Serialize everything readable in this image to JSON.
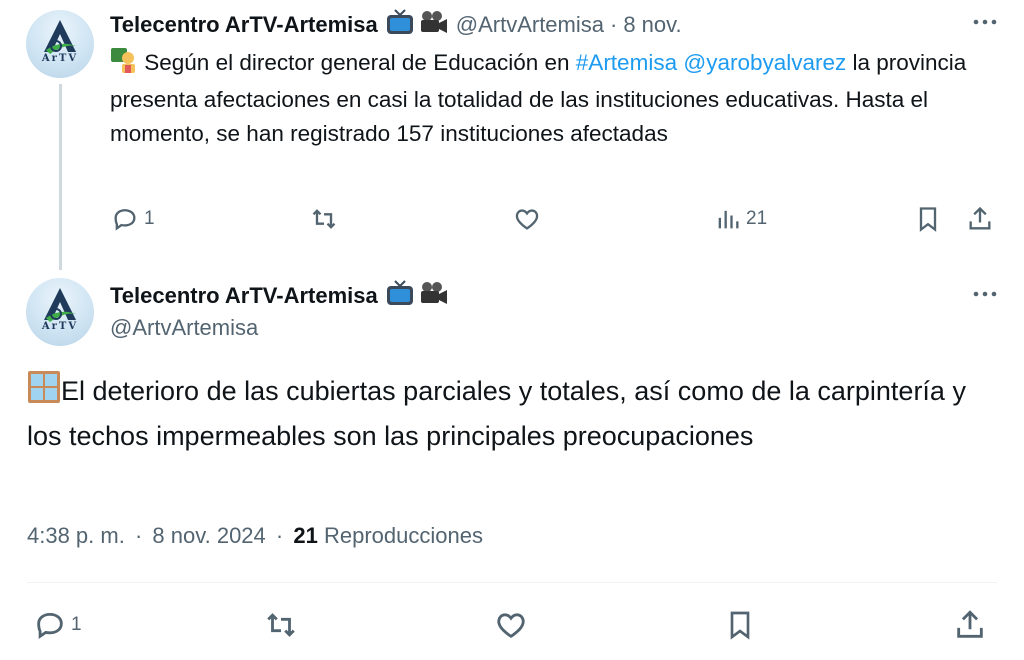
{
  "tweet1": {
    "author_name": "Telecentro ArTV-Artemisa",
    "avatar_text": "ArTV",
    "handle": "@ArtvArtemisa",
    "separator": "·",
    "date": "8 nov.",
    "text_before": " Según el director general de Educación en ",
    "hashtag": "#Artemisa",
    "mention": "@yarobyalvarez",
    "text_after": " la provincia presenta afectaciones en casi la totalidad de las instituciones educativas. Hasta el momento, se han registrado 157 instituciones afectadas",
    "replies": "1",
    "views": "21"
  },
  "tweet2": {
    "author_name": "Telecentro ArTV-Artemisa",
    "avatar_text": "ArTV",
    "handle": "@ArtvArtemisa",
    "text": "El deterioro de las cubiertas parciales y totales, así como de la carpintería y los techos impermeables son las principales preocupaciones",
    "time": "4:38 p. m.",
    "separator": "·",
    "date": "8 nov. 2024",
    "separator2": "·",
    "views_count": "21",
    "views_label": "Reproducciones",
    "replies": "1"
  },
  "icons": {
    "more": "more-icon",
    "tv": "tv-emoji-icon",
    "camera": "movie-camera-emoji-icon",
    "teacher": "teacher-emoji-icon",
    "window": "window-emoji-icon",
    "reply": "reply-icon",
    "retweet": "retweet-icon",
    "like": "like-icon",
    "views": "views-icon",
    "bookmark": "bookmark-icon",
    "share": "share-icon"
  },
  "colors": {
    "link": "#1d9bf0",
    "muted": "#536471",
    "text": "#0f1419",
    "thread_line": "#cfd9de"
  }
}
